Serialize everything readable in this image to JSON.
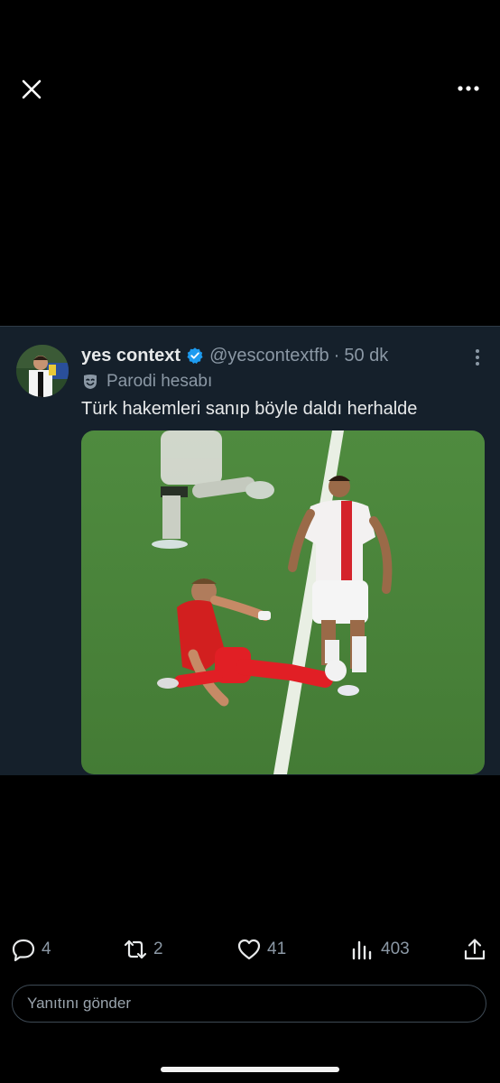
{
  "topbar": {
    "close_icon": "close-icon",
    "more_icon": "more-horizontal-icon"
  },
  "tweet": {
    "display_name": "yes context",
    "handle": "@yescontextfb",
    "separator": "·",
    "time": "50 dk",
    "parody_label": "Parodi hesabı",
    "text": "Türk hakemleri sanıp böyle daldı herhalde",
    "colors": {
      "verified": "#1d9bf0",
      "card_bg": "#15202b",
      "pitch": "#4e8a3e"
    }
  },
  "actions": {
    "replies": "4",
    "reposts": "2",
    "likes": "41",
    "views": "403"
  },
  "reply": {
    "placeholder": "Yanıtını gönder"
  }
}
